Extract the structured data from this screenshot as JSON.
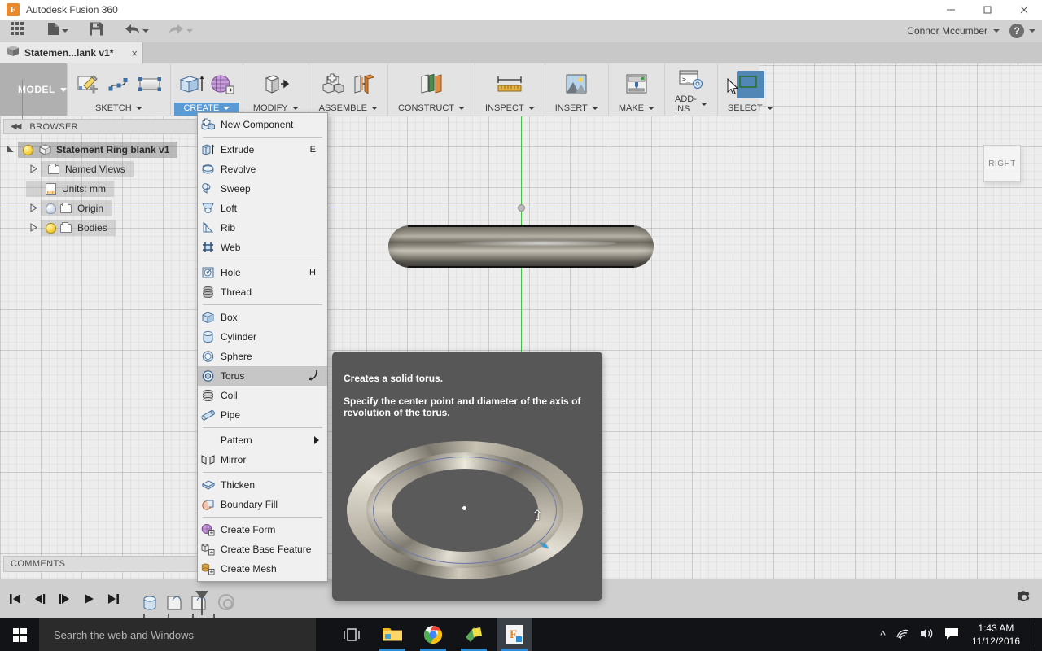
{
  "window": {
    "app_title": "Autodesk Fusion 360",
    "logo_letter": "F",
    "minimize": "minimize-icon",
    "maximize": "maximize-icon",
    "close": "close-icon"
  },
  "quick_access": {
    "items": [
      {
        "name": "show-data-panel",
        "icon": "grid-icon",
        "has_caret": false
      },
      {
        "name": "file-menu",
        "icon": "file-icon",
        "has_caret": true
      },
      {
        "name": "save",
        "icon": "save-icon",
        "has_caret": false
      },
      {
        "name": "undo",
        "icon": "undo-arrow-icon",
        "has_caret": true
      },
      {
        "name": "redo",
        "icon": "redo-arrow-icon",
        "has_caret": true
      }
    ],
    "user_name": "Connor Mccumber",
    "help_label": "?"
  },
  "document_tab": {
    "label": "Statemen...lank v1*",
    "close": "×"
  },
  "ribbon": {
    "workspace_label": "MODEL",
    "groups": [
      {
        "label": "SKETCH",
        "active": false,
        "icons": [
          "create-sketch-icon",
          "spline-icon",
          "rectangle-icon"
        ]
      },
      {
        "label": "CREATE",
        "active": true,
        "icons": [
          "extrude-icon",
          "create-form-icon"
        ]
      },
      {
        "label": "MODIFY",
        "active": false,
        "icons": [
          "press-pull-icon"
        ]
      },
      {
        "label": "ASSEMBLE",
        "active": false,
        "icons": [
          "new-component-icon",
          "joint-icon"
        ]
      },
      {
        "label": "CONSTRUCT",
        "active": false,
        "icons": [
          "offset-plane-icon"
        ]
      },
      {
        "label": "INSPECT",
        "active": false,
        "icons": [
          "measure-icon"
        ]
      },
      {
        "label": "INSERT",
        "active": false,
        "icons": [
          "insert-image-icon"
        ]
      },
      {
        "label": "MAKE",
        "active": false,
        "icons": [
          "3d-print-icon"
        ]
      },
      {
        "label": "ADD-INS",
        "active": false,
        "icons": [
          "scripts-addins-icon"
        ]
      },
      {
        "label": "SELECT",
        "active": false,
        "icons": [
          "select-window-icon"
        ]
      }
    ]
  },
  "browser": {
    "title": "BROWSER",
    "collapse_icon": "double-left-chevron-icon",
    "nodes": [
      {
        "label": "Statement Ring blank v1",
        "level": 0,
        "expander": "expanded",
        "bulb": "on",
        "icon": "component-cube-icon",
        "root": true
      },
      {
        "label": "Named Views",
        "level": 1,
        "expander": "collapsed",
        "bulb": "none",
        "icon": "folder-icon",
        "root": false
      },
      {
        "label": "Units: mm",
        "level": 2,
        "expander": "none",
        "bulb": "none",
        "icon": "units-doc-icon",
        "root": false
      },
      {
        "label": "Origin",
        "level": 1,
        "expander": "collapsed",
        "bulb": "off",
        "icon": "folder-icon",
        "root": false
      },
      {
        "label": "Bodies",
        "level": 1,
        "expander": "collapsed",
        "bulb": "on",
        "icon": "folder-icon",
        "root": false
      }
    ]
  },
  "create_menu": {
    "items": [
      {
        "label": "New Component",
        "icon": "new-component-icon",
        "shortcut": "",
        "type": "item",
        "highlight": false
      },
      {
        "type": "separator"
      },
      {
        "label": "Extrude",
        "icon": "extrude-icon",
        "shortcut": "E",
        "type": "item",
        "highlight": false
      },
      {
        "label": "Revolve",
        "icon": "revolve-icon",
        "shortcut": "",
        "type": "item",
        "highlight": false
      },
      {
        "label": "Sweep",
        "icon": "sweep-icon",
        "shortcut": "",
        "type": "item",
        "highlight": false
      },
      {
        "label": "Loft",
        "icon": "loft-icon",
        "shortcut": "",
        "type": "item",
        "highlight": false
      },
      {
        "label": "Rib",
        "icon": "rib-icon",
        "shortcut": "",
        "type": "item",
        "highlight": false
      },
      {
        "label": "Web",
        "icon": "web-icon",
        "shortcut": "",
        "type": "item",
        "highlight": false
      },
      {
        "type": "separator"
      },
      {
        "label": "Hole",
        "icon": "hole-icon",
        "shortcut": "H",
        "type": "item",
        "highlight": false
      },
      {
        "label": "Thread",
        "icon": "thread-icon",
        "shortcut": "",
        "type": "item",
        "highlight": false
      },
      {
        "type": "separator"
      },
      {
        "label": "Box",
        "icon": "box-icon",
        "shortcut": "",
        "type": "item",
        "highlight": false
      },
      {
        "label": "Cylinder",
        "icon": "cylinder-icon",
        "shortcut": "",
        "type": "item",
        "highlight": false
      },
      {
        "label": "Sphere",
        "icon": "sphere-icon",
        "shortcut": "",
        "type": "item",
        "highlight": false
      },
      {
        "label": "Torus",
        "icon": "torus-icon",
        "shortcut": "",
        "type": "item",
        "highlight": true,
        "trailing": "arc-icon"
      },
      {
        "label": "Coil",
        "icon": "coil-icon",
        "shortcut": "",
        "type": "item",
        "highlight": false
      },
      {
        "label": "Pipe",
        "icon": "pipe-icon",
        "shortcut": "",
        "type": "item",
        "highlight": false
      },
      {
        "type": "separator"
      },
      {
        "label": "Pattern",
        "icon": "",
        "shortcut": "",
        "type": "submenu",
        "highlight": false
      },
      {
        "label": "Mirror",
        "icon": "mirror-icon",
        "shortcut": "",
        "type": "item",
        "highlight": false
      },
      {
        "type": "separator"
      },
      {
        "label": "Thicken",
        "icon": "thicken-icon",
        "shortcut": "",
        "type": "item",
        "highlight": false
      },
      {
        "label": "Boundary Fill",
        "icon": "boundary-fill-icon",
        "shortcut": "",
        "type": "item",
        "highlight": false
      },
      {
        "type": "separator"
      },
      {
        "label": "Create Form",
        "icon": "create-form-icon",
        "shortcut": "",
        "type": "item",
        "highlight": false
      },
      {
        "label": "Create Base Feature",
        "icon": "create-base-feature-icon",
        "shortcut": "",
        "type": "item",
        "highlight": false
      },
      {
        "label": "Create Mesh",
        "icon": "create-mesh-icon",
        "shortcut": "",
        "type": "item",
        "highlight": false
      }
    ]
  },
  "tooltip": {
    "title": "Creates a solid torus.",
    "body": "Specify the center point and diameter of the axis of revolution of the torus.",
    "preview_name": "torus-preview-image"
  },
  "viewport": {
    "view_cube_label": "RIGHT",
    "model_name": "ring-body",
    "origin_marker": "origin-point",
    "display_settings": "display-settings-icon"
  },
  "comments": {
    "label": "COMMENTS",
    "add_icon": "add-comment-icon"
  },
  "timeline": {
    "buttons": [
      {
        "name": "go-to-beginning",
        "glyph": "⏮"
      },
      {
        "name": "step-back",
        "glyph": "◀"
      },
      {
        "name": "step-forward",
        "glyph": "▶"
      },
      {
        "name": "play",
        "glyph": "▶"
      },
      {
        "name": "go-to-end",
        "glyph": "⏭"
      }
    ],
    "features": [
      "cylinder-feature-icon",
      "fillet-feature-icon",
      "fillet-feature-icon"
    ],
    "settings_icon": "timeline-settings-gear-icon"
  },
  "taskbar": {
    "start": "windows-start-icon",
    "search_placeholder": "Search the web and Windows",
    "task_view": "task-view-icon",
    "apps": [
      {
        "name": "file-explorer-icon",
        "running": true
      },
      {
        "name": "google-chrome-icon",
        "running": true
      },
      {
        "name": "sticky-notes-icon",
        "running": true
      },
      {
        "name": "fusion-360-icon",
        "running": true,
        "active": true
      }
    ],
    "tray": {
      "show_hidden": "chevron-up-icon",
      "network": "wifi-icon",
      "volume": "speaker-icon",
      "action_center": "notifications-icon",
      "time": "1:43 AM",
      "date": "11/12/2016"
    }
  },
  "colors": {
    "accent_blue": "#5b9bd5",
    "select_blue": "#5087b7",
    "viewport_bg": "#ededed",
    "ribbon_bg": "#e3e3e3",
    "tooltip_bg": "#575757",
    "taskbar_bg": "#111317",
    "green_axis": "#3ec43e",
    "blue_axis": "#8f8fd0",
    "logo_orange": "#e8892b"
  }
}
